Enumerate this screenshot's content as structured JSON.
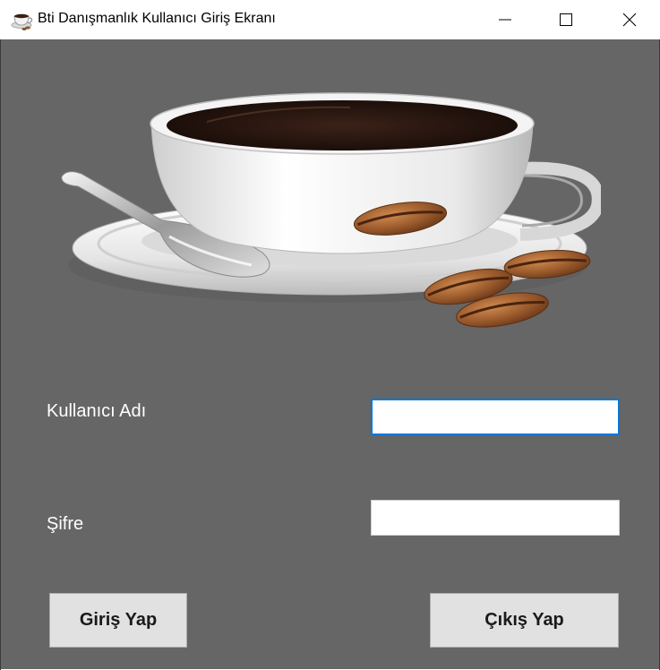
{
  "window": {
    "title": "Bti Danışmanlık Kullanıcı Giriş Ekranı",
    "icons": {
      "app": "coffee-cup-icon",
      "minimize": "minimize-icon",
      "maximize": "maximize-icon",
      "close": "close-icon"
    }
  },
  "form": {
    "username_label": "Kullanıcı Adı",
    "password_label": "Şifre",
    "username_value": "",
    "password_value": "",
    "login_button": "Giriş Yap",
    "exit_button": "Çıkış Yap"
  },
  "colors": {
    "background": "#666666",
    "focus_border": "#0078d7",
    "button_face": "#e1e1e1",
    "label_text": "#ffffff"
  }
}
